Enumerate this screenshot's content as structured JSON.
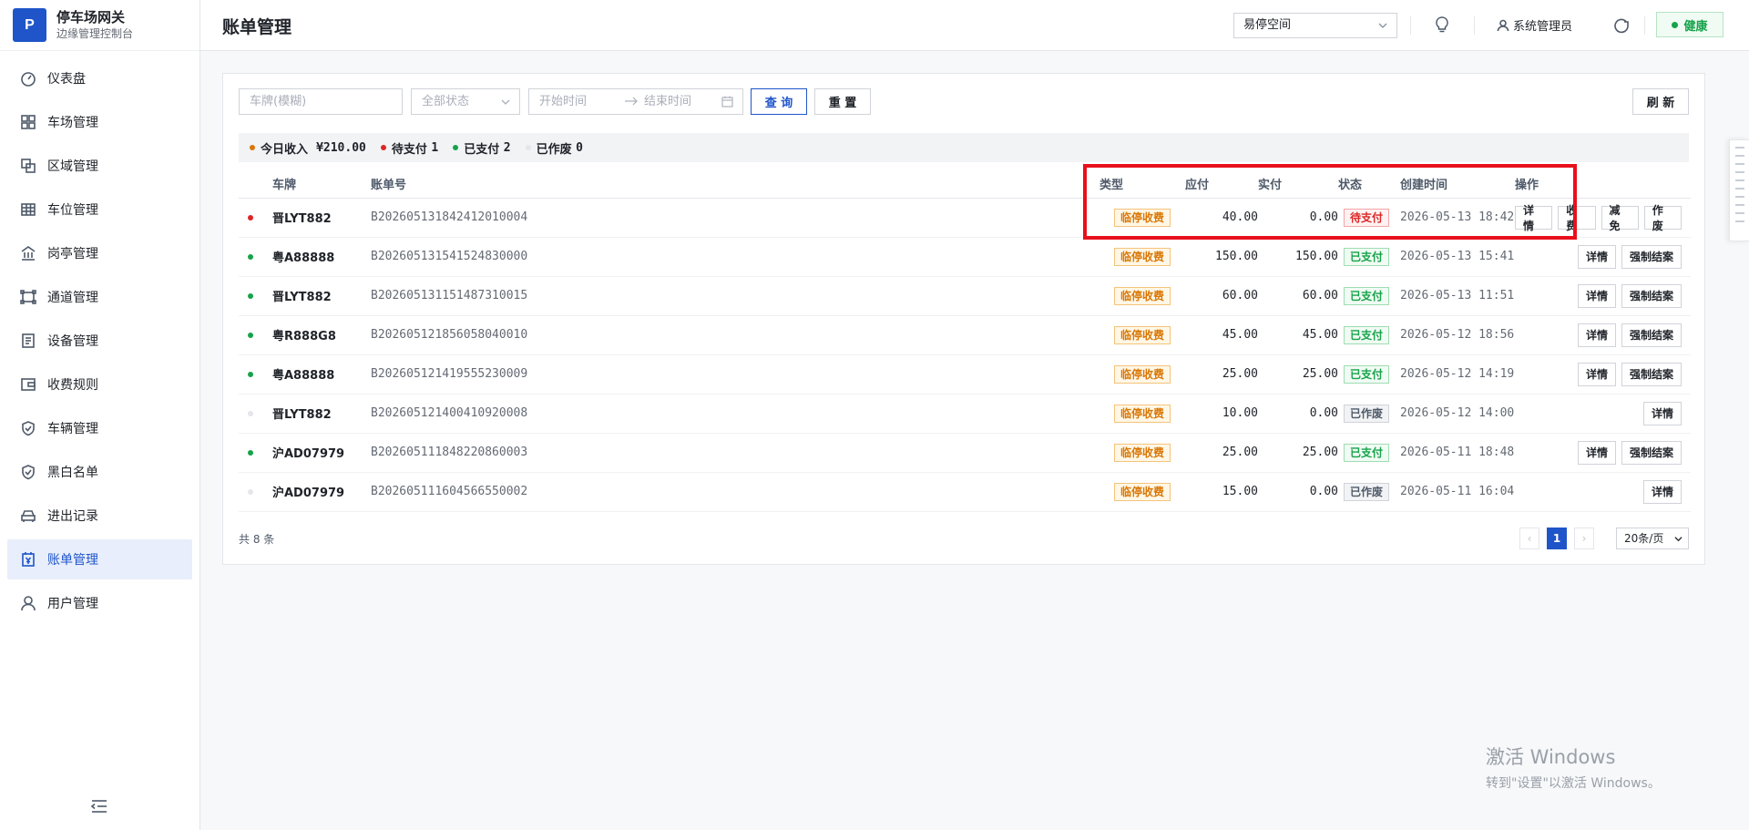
{
  "brand": {
    "logo": "P",
    "title": "停车场网关",
    "subtitle": "边缘管理控制台"
  },
  "sidebar": {
    "items": [
      {
        "label": "仪表盘",
        "icon": "dashboard-icon"
      },
      {
        "label": "车场管理",
        "icon": "grid-icon"
      },
      {
        "label": "区域管理",
        "icon": "layers-icon"
      },
      {
        "label": "车位管理",
        "icon": "table-icon"
      },
      {
        "label": "岗亭管理",
        "icon": "building-icon"
      },
      {
        "label": "通道管理",
        "icon": "channel-icon"
      },
      {
        "label": "设备管理",
        "icon": "device-icon"
      },
      {
        "label": "收费规则",
        "icon": "wallet-icon"
      },
      {
        "label": "车辆管理",
        "icon": "shield-icon"
      },
      {
        "label": "黑白名单",
        "icon": "shield-check-icon"
      },
      {
        "label": "进出记录",
        "icon": "car-icon"
      },
      {
        "label": "账单管理",
        "icon": "bill-icon",
        "active": true
      },
      {
        "label": "用户管理",
        "icon": "user-icon"
      }
    ]
  },
  "header": {
    "title": "账单管理",
    "site": "易停空间",
    "user": "系统管理员",
    "health": "健康"
  },
  "filters": {
    "plate_placeholder": "车牌(模糊)",
    "status": "全部状态",
    "start_placeholder": "开始时间",
    "end_placeholder": "结束时间",
    "query": "查 询",
    "reset": "重 置",
    "refresh": "刷 新"
  },
  "summary": {
    "income_label": "今日收入",
    "income_value": "¥210.00",
    "unpaid_label": "待支付",
    "unpaid_count": "1",
    "paid_label": "已支付",
    "paid_count": "2",
    "void_label": "已作废",
    "void_count": "0",
    "colors": {
      "income": "#d97706",
      "unpaid": "#dc2626",
      "paid": "#16a34a",
      "void": "#e5e6eb"
    }
  },
  "table": {
    "columns": {
      "plate": "车牌",
      "bill_no": "账单号",
      "type": "类型",
      "due": "应付",
      "paid": "实付",
      "status": "状态",
      "created": "创建时间",
      "ops": "操作"
    },
    "rows": [
      {
        "plate": "晋LYT882",
        "bill_no": "B202605131842412010004",
        "type": "临停收费",
        "due": "40.00",
        "paid": "0.00",
        "status": "待支付",
        "status_kind": "unpaid",
        "created": "2026-05-13 18:42",
        "ops": [
          "详情",
          "收费",
          "减免",
          "作废"
        ]
      },
      {
        "plate": "粤A88888",
        "bill_no": "B202605131541524830000",
        "type": "临停收费",
        "due": "150.00",
        "paid": "150.00",
        "status": "已支付",
        "status_kind": "paid",
        "created": "2026-05-13 15:41",
        "ops": [
          "详情",
          "强制结案"
        ]
      },
      {
        "plate": "晋LYT882",
        "bill_no": "B202605131151487310015",
        "type": "临停收费",
        "due": "60.00",
        "paid": "60.00",
        "status": "已支付",
        "status_kind": "paid",
        "created": "2026-05-13 11:51",
        "ops": [
          "详情",
          "强制结案"
        ]
      },
      {
        "plate": "粤R888G8",
        "bill_no": "B202605121856058040010",
        "type": "临停收费",
        "due": "45.00",
        "paid": "45.00",
        "status": "已支付",
        "status_kind": "paid",
        "created": "2026-05-12 18:56",
        "ops": [
          "详情",
          "强制结案"
        ]
      },
      {
        "plate": "粤A88888",
        "bill_no": "B202605121419555230009",
        "type": "临停收费",
        "due": "25.00",
        "paid": "25.00",
        "status": "已支付",
        "status_kind": "paid",
        "created": "2026-05-12 14:19",
        "ops": [
          "详情",
          "强制结案"
        ]
      },
      {
        "plate": "晋LYT882",
        "bill_no": "B202605121400410920008",
        "type": "临停收费",
        "due": "10.00",
        "paid": "0.00",
        "status": "已作废",
        "status_kind": "void",
        "created": "2026-05-12 14:00",
        "ops": [
          "详情"
        ]
      },
      {
        "plate": "沪AD07979",
        "bill_no": "B202605111848220860003",
        "type": "临停收费",
        "due": "25.00",
        "paid": "25.00",
        "status": "已支付",
        "status_kind": "paid",
        "created": "2026-05-11 18:48",
        "ops": [
          "详情",
          "强制结案"
        ]
      },
      {
        "plate": "沪AD07979",
        "bill_no": "B202605111604566550002",
        "type": "临停收费",
        "due": "15.00",
        "paid": "0.00",
        "status": "已作废",
        "status_kind": "void",
        "created": "2026-05-11 16:04",
        "ops": [
          "详情"
        ]
      }
    ]
  },
  "pagination": {
    "total": "共 8 条",
    "current": "1",
    "page_size": "20条/页"
  },
  "watermark": {
    "title": "激活 Windows",
    "subtitle": "转到\"设置\"以激活 Windows。"
  }
}
